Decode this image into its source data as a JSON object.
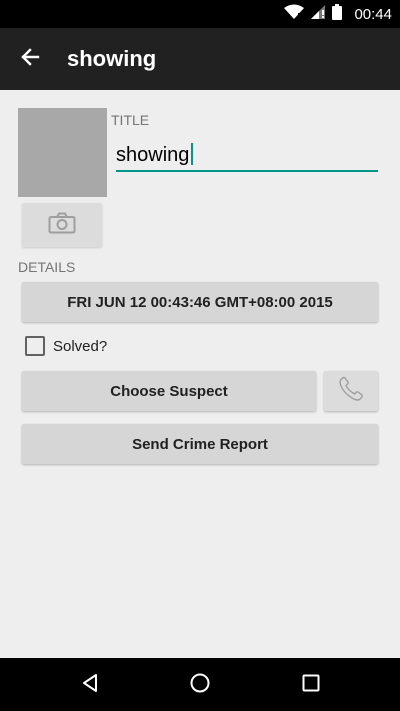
{
  "status_bar": {
    "time": "00:44",
    "icons": [
      "wifi-icon",
      "cell-signal-icon",
      "battery-icon"
    ]
  },
  "app_bar": {
    "title": "showing",
    "back_icon": "arrow-back-icon"
  },
  "crime": {
    "title_label": "TITLE",
    "title_value": "showing",
    "details_label": "DETAILS",
    "date_button_label": "FRI JUN 12 00:43:46 GMT+08:00 2015",
    "solved_label": "Solved?",
    "solved_checked": false,
    "choose_suspect_label": "Choose Suspect",
    "send_report_label": "Send Crime Report"
  },
  "icons": {
    "camera": "camera-icon",
    "phone": "phone-icon"
  },
  "nav_bar": {
    "icons": [
      "nav-back-icon",
      "nav-home-icon",
      "nav-recents-icon"
    ]
  },
  "colors": {
    "accent": "#009688",
    "app_bar": "#212121",
    "background": "#eeeeee",
    "photo_placeholder": "#a8a8a8"
  }
}
